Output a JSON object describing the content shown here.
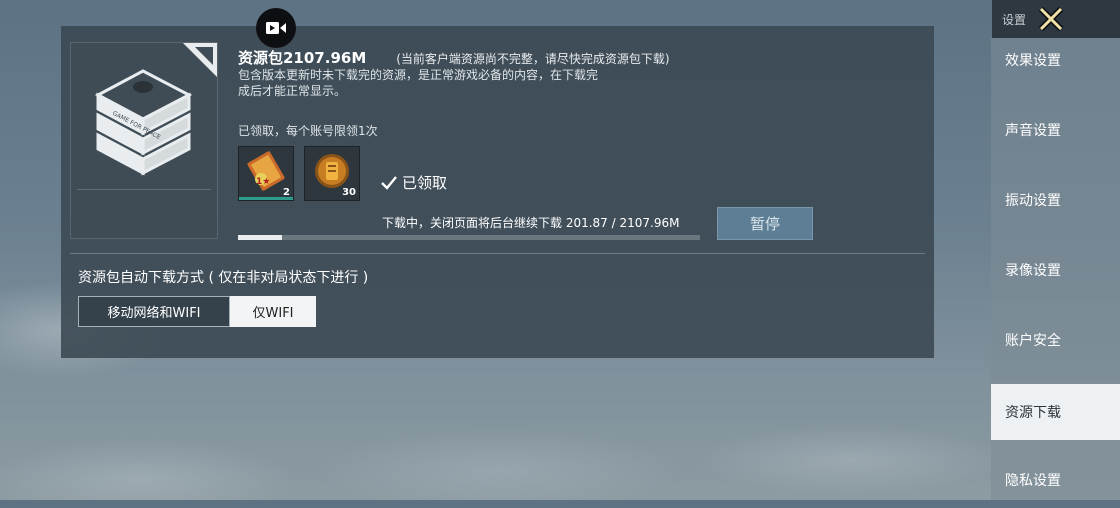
{
  "resource_pack": {
    "title": "资源包2107.96M",
    "hint": "(当前客户端资源尚不完整，请尽快完成资源包下载)",
    "desc_line1": "包含版本更新时未下载完的资源，是正常游戏必备的内容，在下载完",
    "desc_line2": "成后才能正常显示。",
    "claim_note": "已领取，每个账号限领1次",
    "rewards": [
      {
        "name": "reward-card",
        "count": "2"
      },
      {
        "name": "reward-coin",
        "count": "30"
      }
    ],
    "claimed_label": "已领取",
    "download_status": "下载中，关闭页面将后台继续下载 201.87 / 2107.96M",
    "progress_fraction": 0.096,
    "pause_label": "暂停"
  },
  "auto_download": {
    "label": "资源包自动下载方式 ( 仅在非对局状态下进行 )",
    "options": [
      "移动网络和WIFI",
      "仅WIFI"
    ],
    "selected": "仅WIFI"
  },
  "header": {
    "settings_label": "设置"
  },
  "sidebar": {
    "items": [
      {
        "label": "效果设置",
        "active": false
      },
      {
        "label": "声音设置",
        "active": false
      },
      {
        "label": "振动设置",
        "active": false
      },
      {
        "label": "录像设置",
        "active": false
      },
      {
        "label": "账户安全",
        "active": false
      },
      {
        "label": "资源下载",
        "active": true
      },
      {
        "label": "隐私设置",
        "active": false
      }
    ]
  },
  "pack_icon_text": "GAME FOR PEACE",
  "colors": {
    "accent_active_bg": "#eef1f3",
    "pause_button": "#5d7e94",
    "progress_fill": "#e9edef"
  }
}
